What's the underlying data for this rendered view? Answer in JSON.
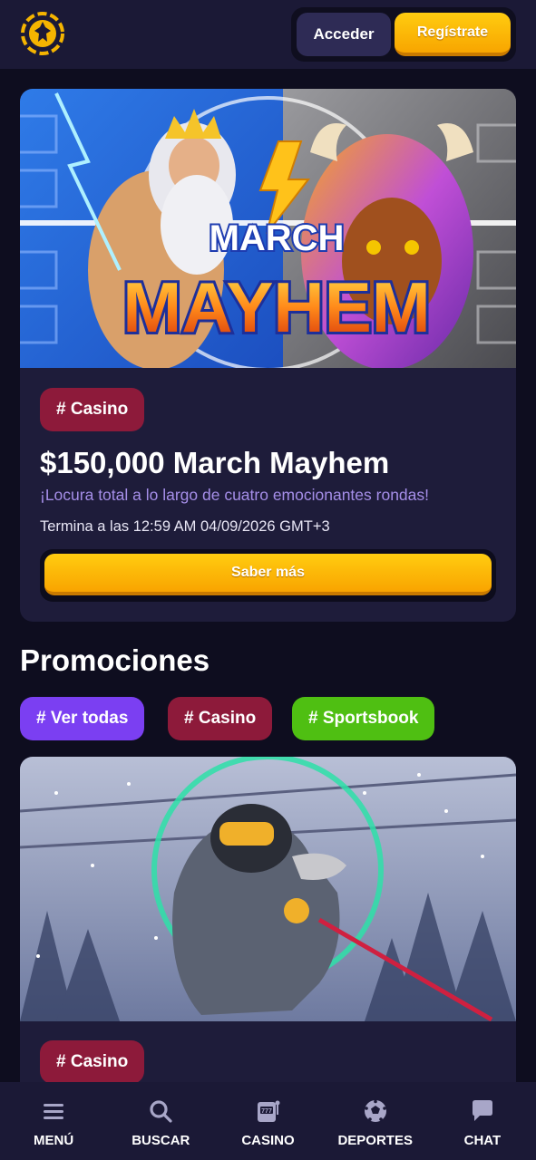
{
  "header": {
    "login_label": "Acceder",
    "register_label": "Regístrate"
  },
  "hero": {
    "banner_text_1": "MARCH",
    "banner_text_2": "MAYHEM",
    "tag": "# Casino",
    "title": "$150,000 March Mayhem",
    "subtitle": "¡Locura total a lo largo de cuatro emocionantes rondas!",
    "end_text": "Termina a las 12:59 AM 04/09/2026 GMT+3",
    "cta_label": "Saber más"
  },
  "promotions": {
    "heading": "Promociones",
    "filters": [
      "# Ver todas",
      "# Casino",
      "# Sportsbook"
    ],
    "card": {
      "tag": "# Casino"
    }
  },
  "bottom_nav": [
    {
      "label": "MENÚ",
      "icon": "menu-icon"
    },
    {
      "label": "BUSCAR",
      "icon": "search-icon"
    },
    {
      "label": "CASINO",
      "icon": "slot-machine-icon"
    },
    {
      "label": "DEPORTES",
      "icon": "soccer-ball-icon"
    },
    {
      "label": "CHAT",
      "icon": "chat-bubble-icon"
    }
  ],
  "colors": {
    "background": "#0e0d1f",
    "panel": "#1e1c3a",
    "accent_yellow": "#ffc20e",
    "tag_casino": "#8d1a3a",
    "tag_all": "#7b3ff2",
    "tag_sports": "#4fbf12",
    "subtitle": "#a58ee8"
  }
}
